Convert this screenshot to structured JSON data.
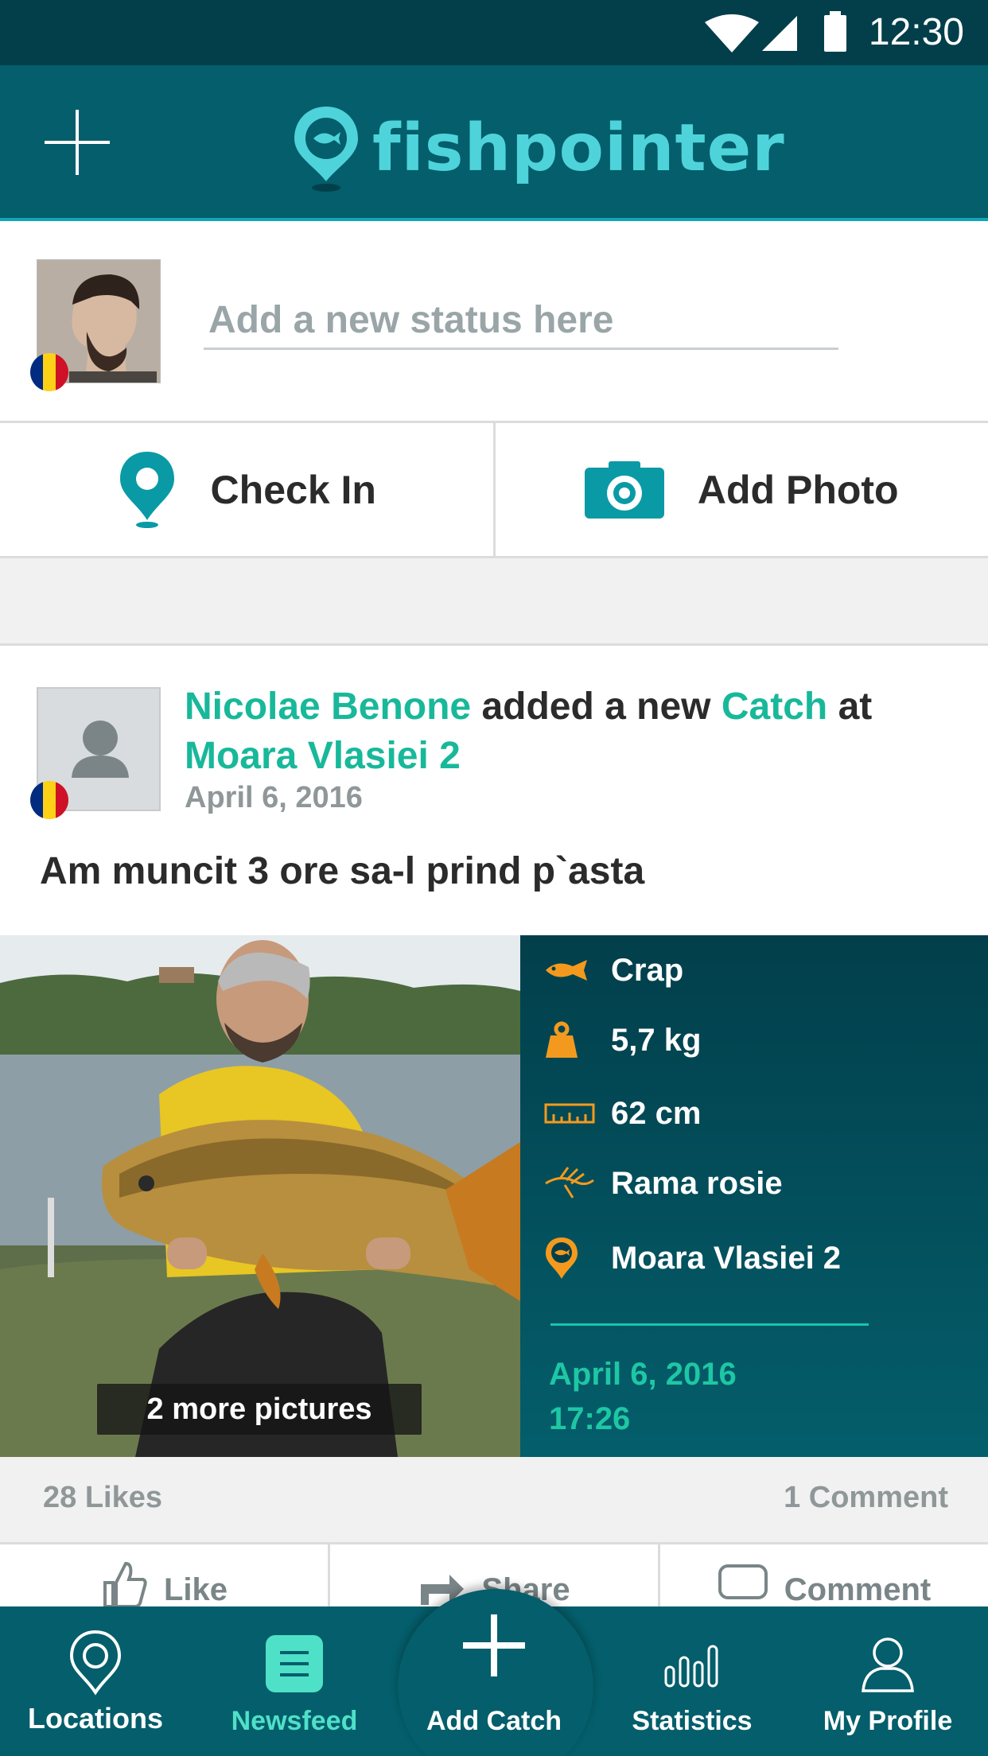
{
  "status_bar": {
    "time": "12:30"
  },
  "app_bar": {
    "logo_text": "fishpointer"
  },
  "composer": {
    "placeholder": "Add a new status here"
  },
  "actions": {
    "check_in": "Check In",
    "add_photo": "Add Photo"
  },
  "post": {
    "author": "Nicolae Benone",
    "mid_text": "added a new",
    "object": "Catch",
    "at_text": "at",
    "location": "Moara Vlasiei 2",
    "date": "April 6, 2016",
    "text": "Am muncit 3 ore sa-l prind p`asta",
    "more_pictures": "2 more pictures",
    "catch": {
      "species": "Crap",
      "weight": "5,7 kg",
      "length": "62 cm",
      "bait": "Rama rosie",
      "location": "Moara Vlasiei 2",
      "date": "April 6, 2016",
      "time": "17:26"
    },
    "likes": "28 Likes",
    "comments": "1 Comment"
  },
  "social": {
    "like": "Like",
    "share": "Share",
    "comment": "Comment"
  },
  "bottom_nav": {
    "locations": "Locations",
    "newsfeed": "Newsfeed",
    "add_catch": "Add Catch",
    "statistics": "Statistics",
    "my_profile": "My Profile"
  },
  "colors": {
    "primary": "#045e6b",
    "dark": "#023f4b",
    "accent": "#18b89a",
    "orange": "#f39a1e",
    "logo": "#4fd3da"
  },
  "flag": [
    "#002b7f",
    "#fcd116",
    "#ce1126"
  ]
}
